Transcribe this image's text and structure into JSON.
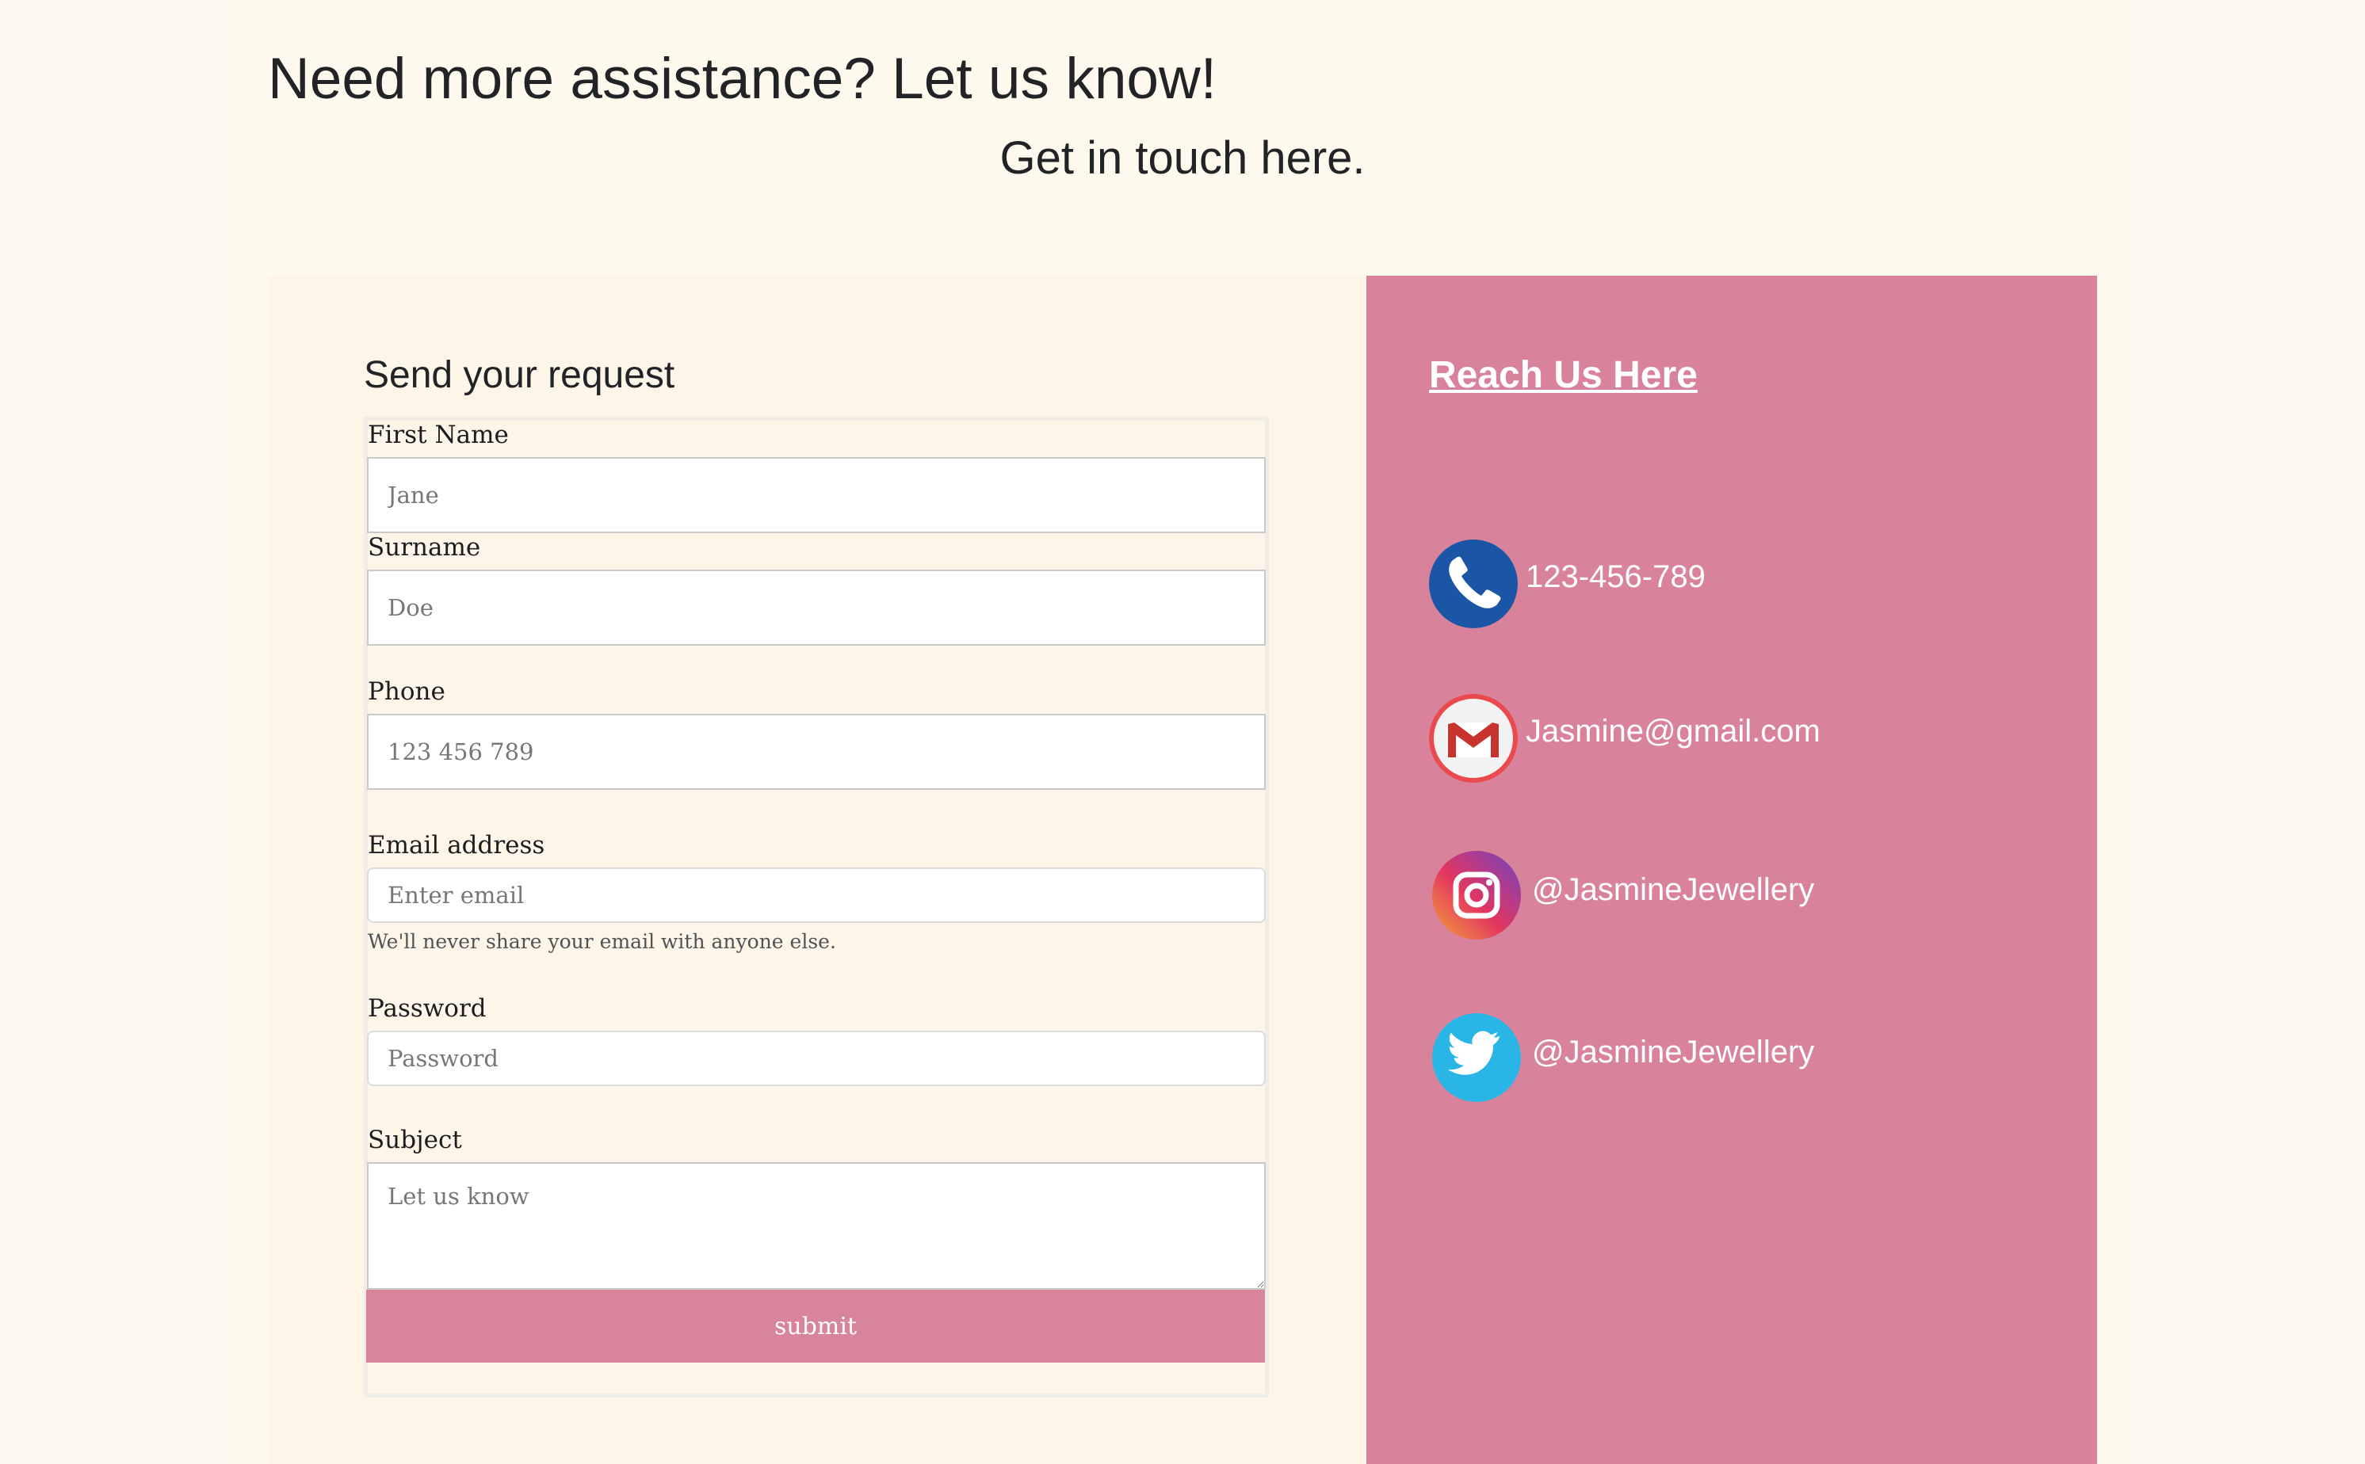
{
  "header": {
    "title": "Need more assistance? Let us know!",
    "subtitle": "Get in touch here."
  },
  "form": {
    "title": "Send your request",
    "first_name": {
      "label": "First Name",
      "placeholder": "Jane",
      "value": ""
    },
    "surname": {
      "label": "Surname",
      "placeholder": "Doe",
      "value": ""
    },
    "phone": {
      "label": "Phone",
      "placeholder": "123 456 789",
      "value": ""
    },
    "email": {
      "label": "Email address",
      "placeholder": "Enter email",
      "value": "",
      "hint": "We'll never share your email with anyone else."
    },
    "password": {
      "label": "Password",
      "placeholder": "Password",
      "value": ""
    },
    "subject": {
      "label": "Subject",
      "placeholder": "Let us know",
      "value": ""
    },
    "submit_label": "submit"
  },
  "contact": {
    "title": "Reach Us Here",
    "items": [
      {
        "icon": "phone-icon",
        "text": "123-456-789",
        "color": "#1b56a6"
      },
      {
        "icon": "gmail-icon",
        "text": "Jasmine@gmail.com",
        "color": "#ea4a4d"
      },
      {
        "icon": "instagram-icon",
        "text": "@JasmineJewellery",
        "color": "#c13584"
      },
      {
        "icon": "twitter-icon",
        "text": "@JasmineJewellery",
        "color": "#29b6e6"
      }
    ]
  },
  "colors": {
    "background": "#fdf8ed",
    "accent": "#d8839b",
    "text": "#222326"
  }
}
